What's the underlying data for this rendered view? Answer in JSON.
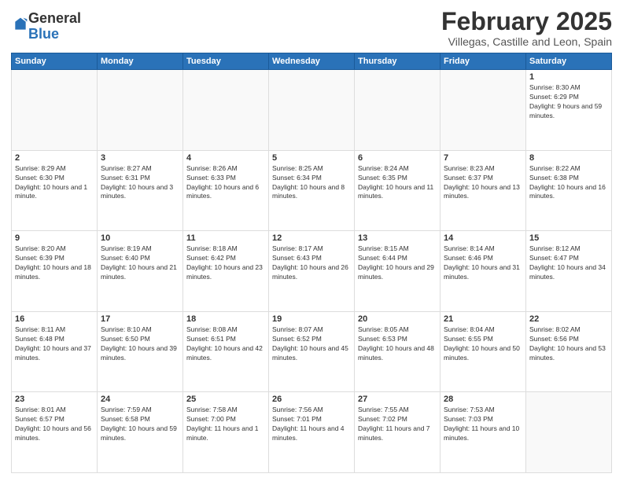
{
  "logo": {
    "general": "General",
    "blue": "Blue"
  },
  "header": {
    "month": "February 2025",
    "location": "Villegas, Castille and Leon, Spain"
  },
  "days_of_week": [
    "Sunday",
    "Monday",
    "Tuesday",
    "Wednesday",
    "Thursday",
    "Friday",
    "Saturday"
  ],
  "weeks": [
    [
      {
        "day": "",
        "info": ""
      },
      {
        "day": "",
        "info": ""
      },
      {
        "day": "",
        "info": ""
      },
      {
        "day": "",
        "info": ""
      },
      {
        "day": "",
        "info": ""
      },
      {
        "day": "",
        "info": ""
      },
      {
        "day": "1",
        "info": "Sunrise: 8:30 AM\nSunset: 6:29 PM\nDaylight: 9 hours and 59 minutes."
      }
    ],
    [
      {
        "day": "2",
        "info": "Sunrise: 8:29 AM\nSunset: 6:30 PM\nDaylight: 10 hours and 1 minute."
      },
      {
        "day": "3",
        "info": "Sunrise: 8:27 AM\nSunset: 6:31 PM\nDaylight: 10 hours and 3 minutes."
      },
      {
        "day": "4",
        "info": "Sunrise: 8:26 AM\nSunset: 6:33 PM\nDaylight: 10 hours and 6 minutes."
      },
      {
        "day": "5",
        "info": "Sunrise: 8:25 AM\nSunset: 6:34 PM\nDaylight: 10 hours and 8 minutes."
      },
      {
        "day": "6",
        "info": "Sunrise: 8:24 AM\nSunset: 6:35 PM\nDaylight: 10 hours and 11 minutes."
      },
      {
        "day": "7",
        "info": "Sunrise: 8:23 AM\nSunset: 6:37 PM\nDaylight: 10 hours and 13 minutes."
      },
      {
        "day": "8",
        "info": "Sunrise: 8:22 AM\nSunset: 6:38 PM\nDaylight: 10 hours and 16 minutes."
      }
    ],
    [
      {
        "day": "9",
        "info": "Sunrise: 8:20 AM\nSunset: 6:39 PM\nDaylight: 10 hours and 18 minutes."
      },
      {
        "day": "10",
        "info": "Sunrise: 8:19 AM\nSunset: 6:40 PM\nDaylight: 10 hours and 21 minutes."
      },
      {
        "day": "11",
        "info": "Sunrise: 8:18 AM\nSunset: 6:42 PM\nDaylight: 10 hours and 23 minutes."
      },
      {
        "day": "12",
        "info": "Sunrise: 8:17 AM\nSunset: 6:43 PM\nDaylight: 10 hours and 26 minutes."
      },
      {
        "day": "13",
        "info": "Sunrise: 8:15 AM\nSunset: 6:44 PM\nDaylight: 10 hours and 29 minutes."
      },
      {
        "day": "14",
        "info": "Sunrise: 8:14 AM\nSunset: 6:46 PM\nDaylight: 10 hours and 31 minutes."
      },
      {
        "day": "15",
        "info": "Sunrise: 8:12 AM\nSunset: 6:47 PM\nDaylight: 10 hours and 34 minutes."
      }
    ],
    [
      {
        "day": "16",
        "info": "Sunrise: 8:11 AM\nSunset: 6:48 PM\nDaylight: 10 hours and 37 minutes."
      },
      {
        "day": "17",
        "info": "Sunrise: 8:10 AM\nSunset: 6:50 PM\nDaylight: 10 hours and 39 minutes."
      },
      {
        "day": "18",
        "info": "Sunrise: 8:08 AM\nSunset: 6:51 PM\nDaylight: 10 hours and 42 minutes."
      },
      {
        "day": "19",
        "info": "Sunrise: 8:07 AM\nSunset: 6:52 PM\nDaylight: 10 hours and 45 minutes."
      },
      {
        "day": "20",
        "info": "Sunrise: 8:05 AM\nSunset: 6:53 PM\nDaylight: 10 hours and 48 minutes."
      },
      {
        "day": "21",
        "info": "Sunrise: 8:04 AM\nSunset: 6:55 PM\nDaylight: 10 hours and 50 minutes."
      },
      {
        "day": "22",
        "info": "Sunrise: 8:02 AM\nSunset: 6:56 PM\nDaylight: 10 hours and 53 minutes."
      }
    ],
    [
      {
        "day": "23",
        "info": "Sunrise: 8:01 AM\nSunset: 6:57 PM\nDaylight: 10 hours and 56 minutes."
      },
      {
        "day": "24",
        "info": "Sunrise: 7:59 AM\nSunset: 6:58 PM\nDaylight: 10 hours and 59 minutes."
      },
      {
        "day": "25",
        "info": "Sunrise: 7:58 AM\nSunset: 7:00 PM\nDaylight: 11 hours and 1 minute."
      },
      {
        "day": "26",
        "info": "Sunrise: 7:56 AM\nSunset: 7:01 PM\nDaylight: 11 hours and 4 minutes."
      },
      {
        "day": "27",
        "info": "Sunrise: 7:55 AM\nSunset: 7:02 PM\nDaylight: 11 hours and 7 minutes."
      },
      {
        "day": "28",
        "info": "Sunrise: 7:53 AM\nSunset: 7:03 PM\nDaylight: 11 hours and 10 minutes."
      },
      {
        "day": "",
        "info": ""
      }
    ]
  ]
}
